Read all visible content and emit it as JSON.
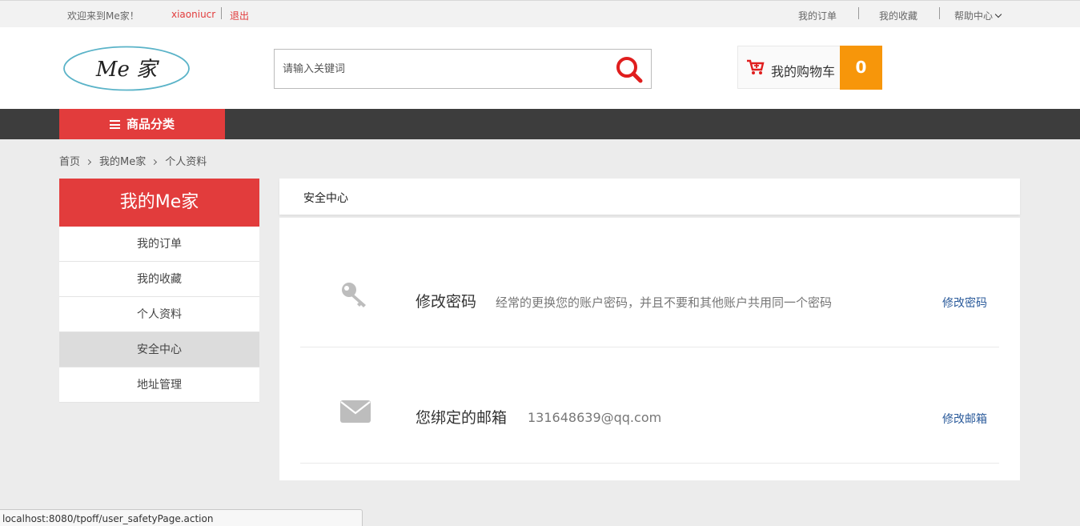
{
  "topbar": {
    "welcome": "欢迎来到Me家！",
    "username": "xiaoniucr",
    "logout": "退出",
    "my_orders": "我的订单",
    "my_favorites": "我的收藏",
    "help_center": "帮助中心"
  },
  "header": {
    "logo_text": "Me 家",
    "search_placeholder": "请输入关键词",
    "cart_label": "我的购物车",
    "cart_count": "0"
  },
  "nav": {
    "category_label": "商品分类"
  },
  "breadcrumb": [
    "首页",
    "我的Me家",
    "个人资料"
  ],
  "sidebar": {
    "title": "我的Me家",
    "items": [
      {
        "label": "我的订单"
      },
      {
        "label": "我的收藏"
      },
      {
        "label": "个人资料"
      },
      {
        "label": "安全中心",
        "active": true
      },
      {
        "label": "地址管理"
      }
    ]
  },
  "main": {
    "heading": "安全中心",
    "rows": [
      {
        "icon": "key-icon",
        "title": "修改密码",
        "description": "经常的更换您的账户密码，并且不要和其他账户共用同一个密码",
        "action": "修改密码"
      },
      {
        "icon": "envelope-icon",
        "title": "您绑定的邮箱",
        "description": "131648639@qq.com",
        "action": "修改邮箱"
      }
    ]
  },
  "statusbar": {
    "url": "localhost:8080/tpoff/user_safetyPage.action"
  },
  "colors": {
    "accent_red": "#e23c3c",
    "cart_orange": "#f7960a",
    "nav_dark": "#3d3d3d",
    "link_blue": "#2a5a9a"
  }
}
